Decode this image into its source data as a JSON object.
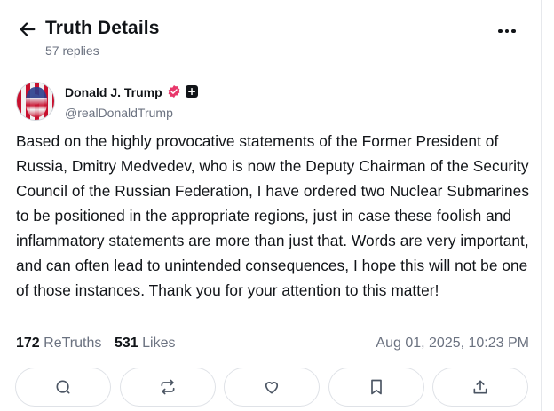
{
  "header": {
    "title": "Truth Details",
    "replies": "57 replies",
    "back_icon": "arrow-left-icon",
    "more_icon": "more-horizontal-icon"
  },
  "author": {
    "name": "Donald J. Trump",
    "handle": "@realDonaldTrump",
    "verified_color": "#e8376b",
    "badge_icon": "plus-badge-icon"
  },
  "post": {
    "text": "Based on the highly provocative statements of the Former President of Russia, Dmitry Medvedev, who is now the Deputy Chairman of the Security Council of the Russian Federation, I have ordered two Nuclear Submarines to be positioned in the appropriate regions, just in case these foolish and inflammatory statements are more than just that. Words are very important, and can often lead to unintended consequences, I hope this will not be one of those instances. Thank you for your attention to this matter!"
  },
  "stats": {
    "retruths_count": "172",
    "retruths_label": "ReTruths",
    "likes_count": "531",
    "likes_label": "Likes",
    "timestamp": "Aug 01, 2025, 10:23 PM"
  },
  "actions": [
    {
      "name": "reply",
      "icon": "comment-icon"
    },
    {
      "name": "retruth",
      "icon": "repost-icon"
    },
    {
      "name": "like",
      "icon": "heart-icon"
    },
    {
      "name": "bookmark",
      "icon": "bookmark-icon"
    },
    {
      "name": "share",
      "icon": "share-icon"
    }
  ],
  "colors": {
    "text": "#111418",
    "muted": "#6b7280",
    "border": "#dfe2e7"
  }
}
